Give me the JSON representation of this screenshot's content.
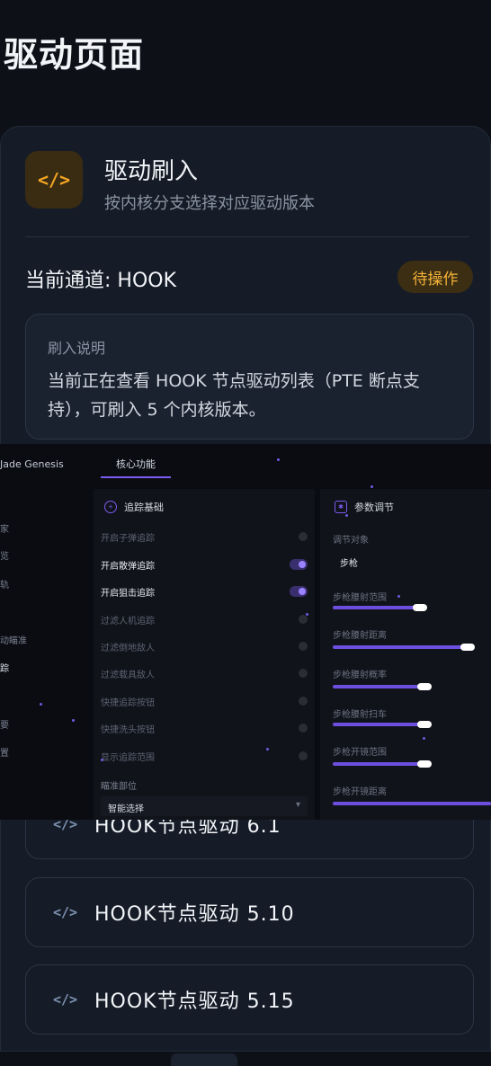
{
  "page": {
    "title": "驱动页面"
  },
  "flash": {
    "icon": "code-icon",
    "icon_glyph": "</>",
    "title": "驱动刷入",
    "subtitle": "按内核分支选择对应驱动版本"
  },
  "channel": {
    "label": "当前通道: HOOK",
    "status": "待操作"
  },
  "note": {
    "title": "刷入说明",
    "body": "当前正在查看 HOOK 节点驱动列表（PTE 断点支持），可刷入 5 个内核版本。"
  },
  "overlay": {
    "app_name": "Jade Genesis",
    "tab": "核心功能",
    "sidebar": [
      "家",
      "览",
      "轨",
      "动瞄准",
      "踪",
      "要",
      "置"
    ],
    "tracking": {
      "title": "追踪基础",
      "rows": [
        {
          "label": "开启子弹追踪",
          "on": false
        },
        {
          "label": "开启散弹追踪",
          "on": true
        },
        {
          "label": "开启狙击追踪",
          "on": true
        },
        {
          "label": "过滤人机追踪",
          "on": false
        },
        {
          "label": "过滤倒地敌人",
          "on": false
        },
        {
          "label": "过滤载具敌人",
          "on": false
        },
        {
          "label": "快捷追踪按钮",
          "on": false
        },
        {
          "label": "快捷洗头按钮",
          "on": false
        },
        {
          "label": "显示追踪范围",
          "on": false
        }
      ],
      "aim_part_label": "瞄准部位",
      "aim_part_value": "智能选择"
    },
    "params": {
      "title": "参数调节",
      "target_label": "调节对象",
      "target_value": "步枪",
      "sliders": [
        {
          "label": "步枪腰射范围",
          "value": 0.55
        },
        {
          "label": "步枪腰射距离",
          "value": 0.85
        },
        {
          "label": "步枪腰射概率",
          "value": 0.58
        },
        {
          "label": "步枪腰射扫车",
          "value": 0.58
        },
        {
          "label": "步枪开镜范围",
          "value": 0.58
        },
        {
          "label": "步枪开镜距离",
          "value": 1.0
        }
      ]
    }
  },
  "kernels": [
    {
      "icon": "code-icon",
      "label": "HOOK节点驱动 6.1"
    },
    {
      "icon": "code-icon",
      "label": "HOOK节点驱动 5.10"
    },
    {
      "icon": "code-icon",
      "label": "HOOK节点驱动 5.15"
    }
  ]
}
